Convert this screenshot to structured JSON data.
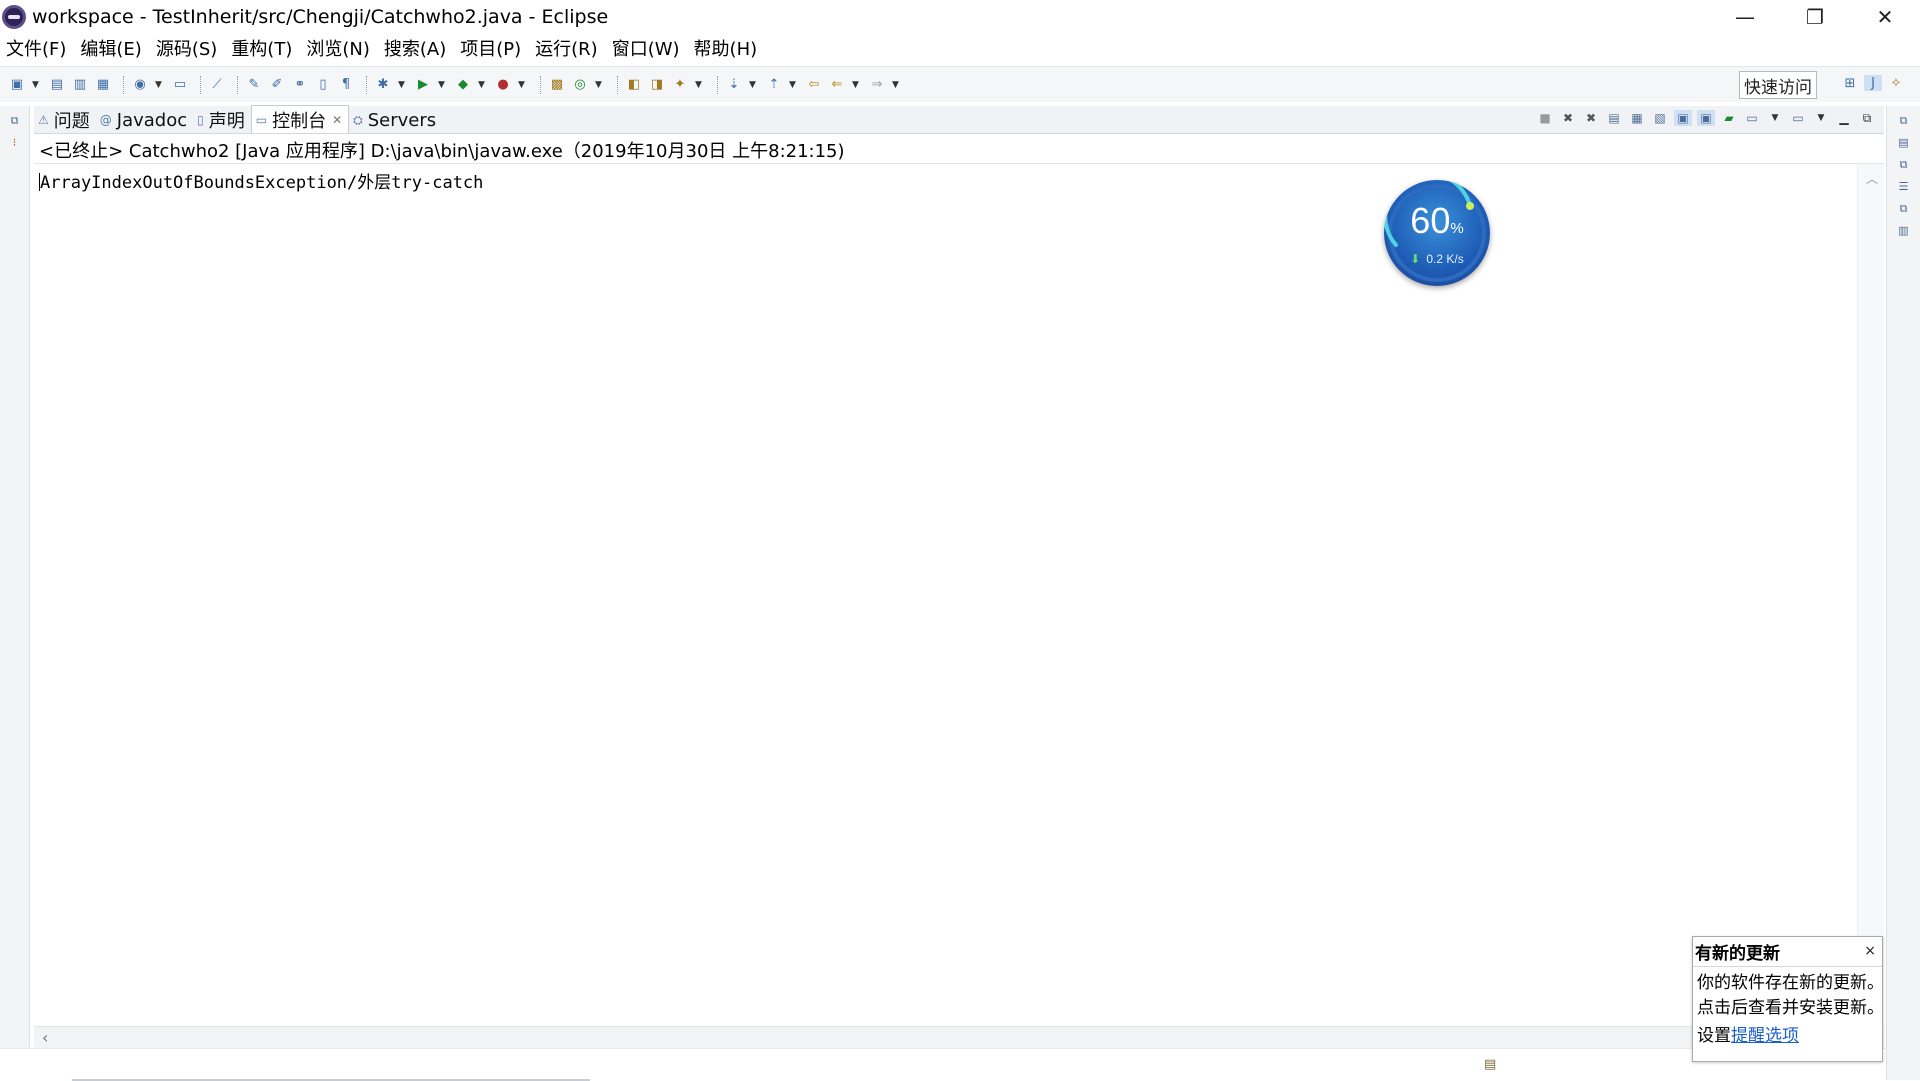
{
  "window": {
    "title": "workspace - TestInherit/src/Chengji/Catchwho2.java - Eclipse",
    "minimize": "—",
    "restore": "❐",
    "close": "✕"
  },
  "menu": [
    "文件(F)",
    "编辑(E)",
    "源码(S)",
    "重构(T)",
    "浏览(N)",
    "搜索(A)",
    "项目(P)",
    "运行(R)",
    "窗口(W)",
    "帮助(H)"
  ],
  "toolbar": {
    "quick_access": "快速访问"
  },
  "tabs": [
    {
      "label": "问题",
      "icon": "problems-icon"
    },
    {
      "label": "Javadoc",
      "icon": "javadoc-icon"
    },
    {
      "label": "声明",
      "icon": "declaration-icon"
    },
    {
      "label": "控制台",
      "icon": "console-icon",
      "active": true
    },
    {
      "label": "Servers",
      "icon": "servers-icon"
    }
  ],
  "console": {
    "status": "<已终止> Catchwho2 [Java 应用程序] D:\\java\\bin\\javaw.exe（2019年10月30日 上午8:21:15)",
    "output": "ArrayIndexOutOfBoundsException/外层try-catch"
  },
  "gauge": {
    "value": "60",
    "unit": "%",
    "speed": "0.2 K/s"
  },
  "notification": {
    "title": "有新的更新",
    "close": "×",
    "line1": "你的软件存在新的更新。",
    "line2": "点击后查看并安装更新。",
    "settings_prefix": "设置",
    "settings_link": "提醒选项"
  }
}
